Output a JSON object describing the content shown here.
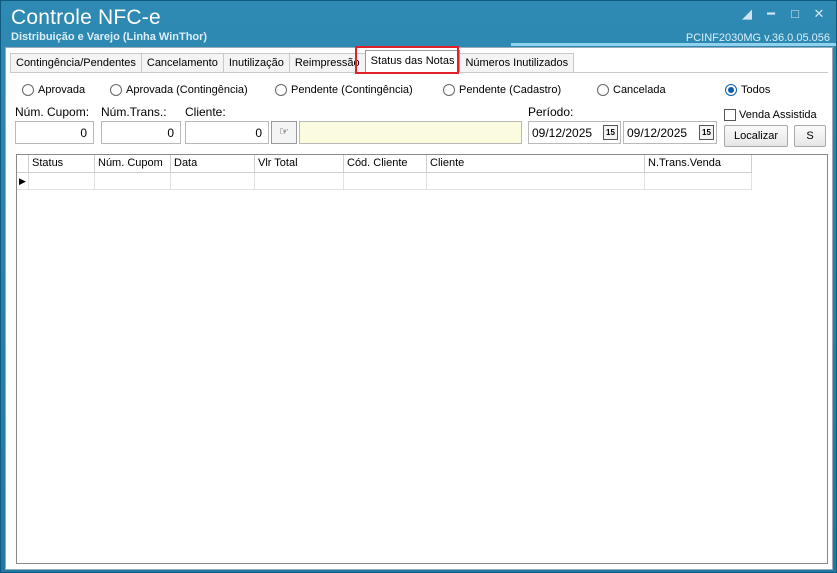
{
  "window": {
    "title": "Controle NFC-e",
    "subtitle": "Distribuição e Varejo (Linha WinThor)",
    "version": "PCINF2030MG  v.36.0.05.056"
  },
  "tabs": [
    {
      "label": "Contingência/Pendentes"
    },
    {
      "label": "Cancelamento"
    },
    {
      "label": "Inutilização"
    },
    {
      "label": "Reimpressão"
    },
    {
      "label": "Status das Notas",
      "active": true
    },
    {
      "label": "Números Inutilizados"
    }
  ],
  "status_filter": {
    "options": [
      "Aprovada",
      "Aprovada (Contingência)",
      "Pendente (Contingência)",
      "Pendente (Cadastro)",
      "Cancelada",
      "Todos"
    ],
    "selected": "Todos"
  },
  "filters": {
    "num_cupom_label": "Núm. Cupom:",
    "num_cupom_value": "0",
    "num_trans_label": "Núm.Trans.:",
    "num_trans_value": "0",
    "cliente_label": "Cliente:",
    "cliente_code_value": "0",
    "cliente_name_value": "",
    "periodo_label": "Período:",
    "date_from": "09/12/2025",
    "date_to": "09/12/2025",
    "calendar_icon_text": "15",
    "venda_assistida_label": "Venda Assistida",
    "venda_assistida_checked": false,
    "localizar_label": "Localizar",
    "s_button_label": "S"
  },
  "grid": {
    "columns": [
      "Status",
      "Núm. Cupom",
      "Data",
      "Vlr Total",
      "Cód. Cliente",
      "Cliente",
      "N.Trans.Venda"
    ],
    "rows": []
  },
  "colors": {
    "title_bar": "#1f7aa3",
    "highlight": "#e0202a",
    "radio_selected": "#0b5fa8",
    "client_field_bg": "#fbfbdf"
  }
}
